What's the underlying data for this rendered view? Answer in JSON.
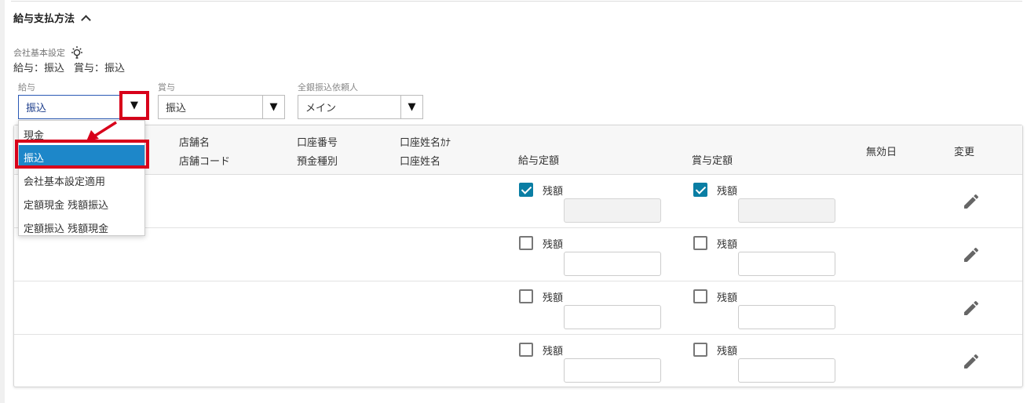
{
  "section": {
    "title": "給与支払方法"
  },
  "company_setting": {
    "label": "会社基本設定",
    "salary_text": "給与：振込",
    "bonus_text": "賞与：振込"
  },
  "fields": {
    "salary": {
      "label": "給与",
      "value": "振込"
    },
    "bonus": {
      "label": "賞与",
      "value": "振込"
    },
    "requester": {
      "label": "全銀振込依頼人",
      "value": "メイン"
    }
  },
  "dropdown": {
    "options": [
      "現金",
      "振込",
      "会社基本設定適用",
      "定額現金 残額振込",
      "定額振込 残額現金"
    ],
    "selected": "振込"
  },
  "table": {
    "headers": {
      "store_name": "店舗名",
      "store_code": "店舗コード",
      "account_number": "口座番号",
      "deposit_type": "預金種別",
      "account_name_kana": "口座姓名ｶﾅ",
      "account_name": "口座姓名",
      "salary_fixed": "給与定額",
      "bonus_fixed": "賞与定額",
      "invalid_date": "無効日",
      "change": "変更"
    },
    "remainder_label": "残額",
    "rows": [
      {
        "salary_remainder": true,
        "bonus_remainder": true,
        "salary_amount": "",
        "bonus_amount": ""
      },
      {
        "salary_remainder": false,
        "bonus_remainder": false,
        "salary_amount": "",
        "bonus_amount": ""
      },
      {
        "salary_remainder": false,
        "bonus_remainder": false,
        "salary_amount": "",
        "bonus_amount": ""
      },
      {
        "salary_remainder": false,
        "bonus_remainder": false,
        "salary_amount": "",
        "bonus_amount": ""
      }
    ]
  },
  "colors": {
    "highlight": "#d8001a",
    "selected_option": "#1d87c9",
    "checkbox": "#0a7ea4"
  },
  "icons": {
    "bulb": "lightbulb-icon",
    "edit": "pencil-icon",
    "collapse": "chevron-up-icon",
    "dropdown": "caret-down-icon"
  }
}
